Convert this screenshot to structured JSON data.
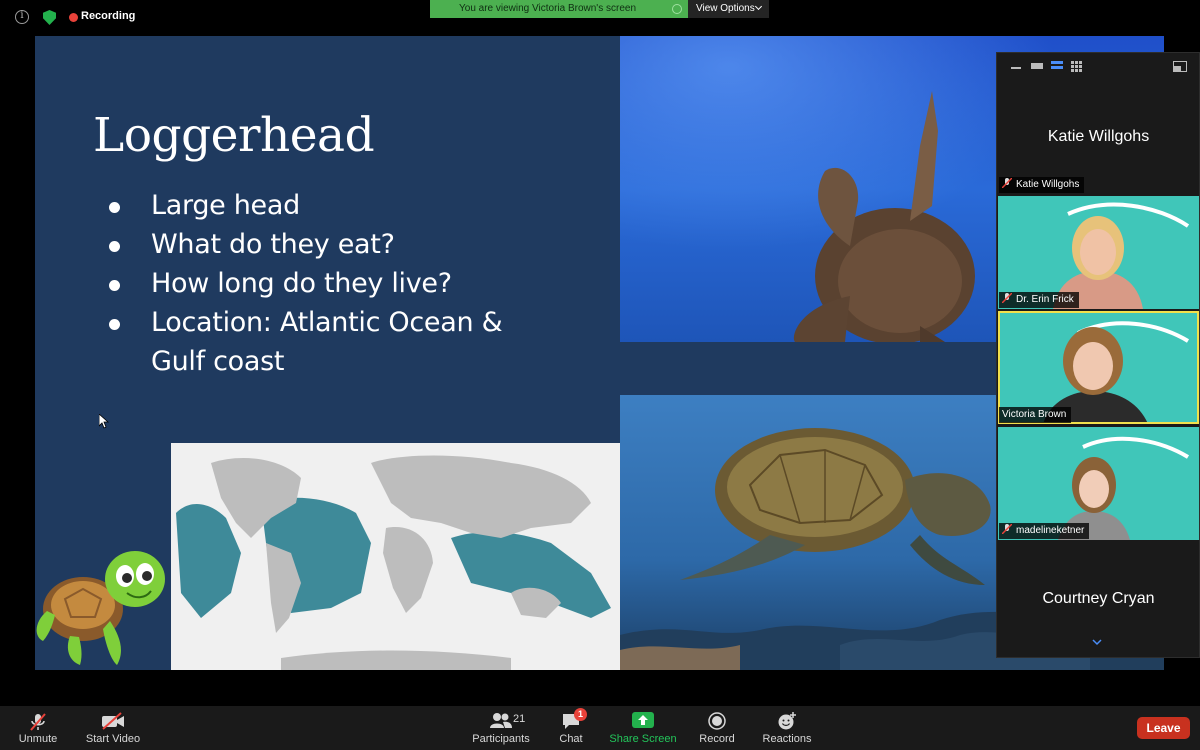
{
  "top_bar": {
    "recording_label": "Recording",
    "viewing_banner": "You are viewing Victoria Brown's screen",
    "view_options_label": "View Options"
  },
  "slide": {
    "title": "Loggerhead",
    "bullets": [
      "Large head",
      "What do they eat?",
      "How long do they live?",
      "Location: Atlantic Ocean & Gulf coast"
    ]
  },
  "gallery": {
    "participants": [
      {
        "display_name": "Katie Willgohs",
        "tag": "Katie Willgohs",
        "muted": true,
        "video": false
      },
      {
        "display_name": "",
        "tag": "Dr. Erin Frick",
        "muted": true,
        "video": true
      },
      {
        "display_name": "",
        "tag": "Victoria Brown",
        "muted": false,
        "video": true,
        "active_speaker": true
      },
      {
        "display_name": "",
        "tag": "madelineketner",
        "muted": true,
        "video": true
      },
      {
        "display_name": "Courtney Cryan",
        "tag": "",
        "muted": true,
        "video": false
      }
    ]
  },
  "controls": {
    "unmute_label": "Unmute",
    "start_video_label": "Start Video",
    "participants_label": "Participants",
    "participants_count": "21",
    "chat_label": "Chat",
    "chat_badge": "1",
    "share_screen_label": "Share Screen",
    "record_label": "Record",
    "reactions_label": "Reactions",
    "leave_label": "Leave"
  },
  "colors": {
    "slide_background": "#1f3a5f",
    "banner_green": "#4cb050",
    "share_green": "#23b14d",
    "leave_red": "#c8311f",
    "active_speaker_outline": "#f1e04c",
    "video_background": "#40c6b9"
  }
}
